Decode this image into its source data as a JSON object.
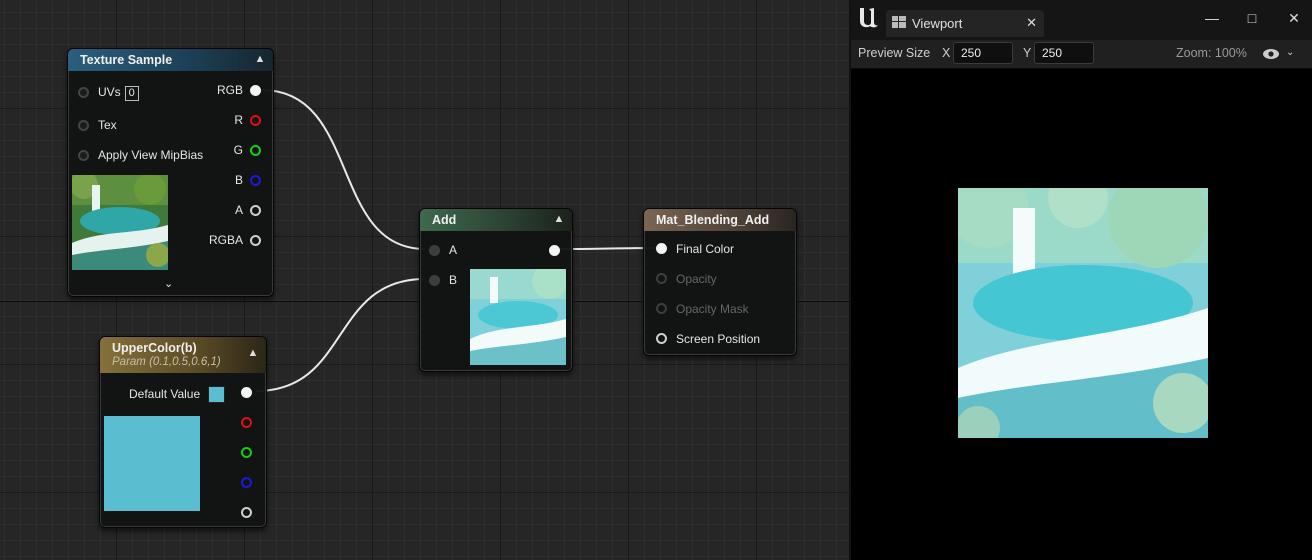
{
  "graph": {
    "nodes": {
      "texture_sample": {
        "title": "Texture Sample",
        "inputs": {
          "uvs": "UVs",
          "uvs_value": "0",
          "tex": "Tex",
          "mip": "Apply View MipBias"
        },
        "outputs": {
          "rgb": "RGB",
          "r": "R",
          "g": "G",
          "b": "B",
          "a": "A",
          "rgba": "RGBA"
        }
      },
      "add": {
        "title": "Add",
        "inputs": {
          "a": "A",
          "b": "B"
        }
      },
      "material": {
        "title": "Mat_Blending_Add",
        "inputs": {
          "final_color": "Final Color",
          "opacity": "Opacity",
          "opacity_mask": "Opacity Mask",
          "screen_position": "Screen Position"
        }
      },
      "upper_color": {
        "title": "UpperColor(b)",
        "subtitle": "Param (0.1,0.5,0.6,1)",
        "default_value": "Default Value",
        "swatch_color": "#5bbdd0"
      }
    }
  },
  "viewport": {
    "tab_title": "Viewport",
    "preview_size_label": "Preview Size",
    "x_label": "X",
    "x_value": "250",
    "y_label": "Y",
    "y_value": "250",
    "zoom": "Zoom: 100%"
  },
  "colors": {
    "pin_red": "#e01010",
    "pin_green": "#10d010",
    "pin_blue": "#1a1ad8",
    "preview_tint": "#5bbdd0"
  }
}
